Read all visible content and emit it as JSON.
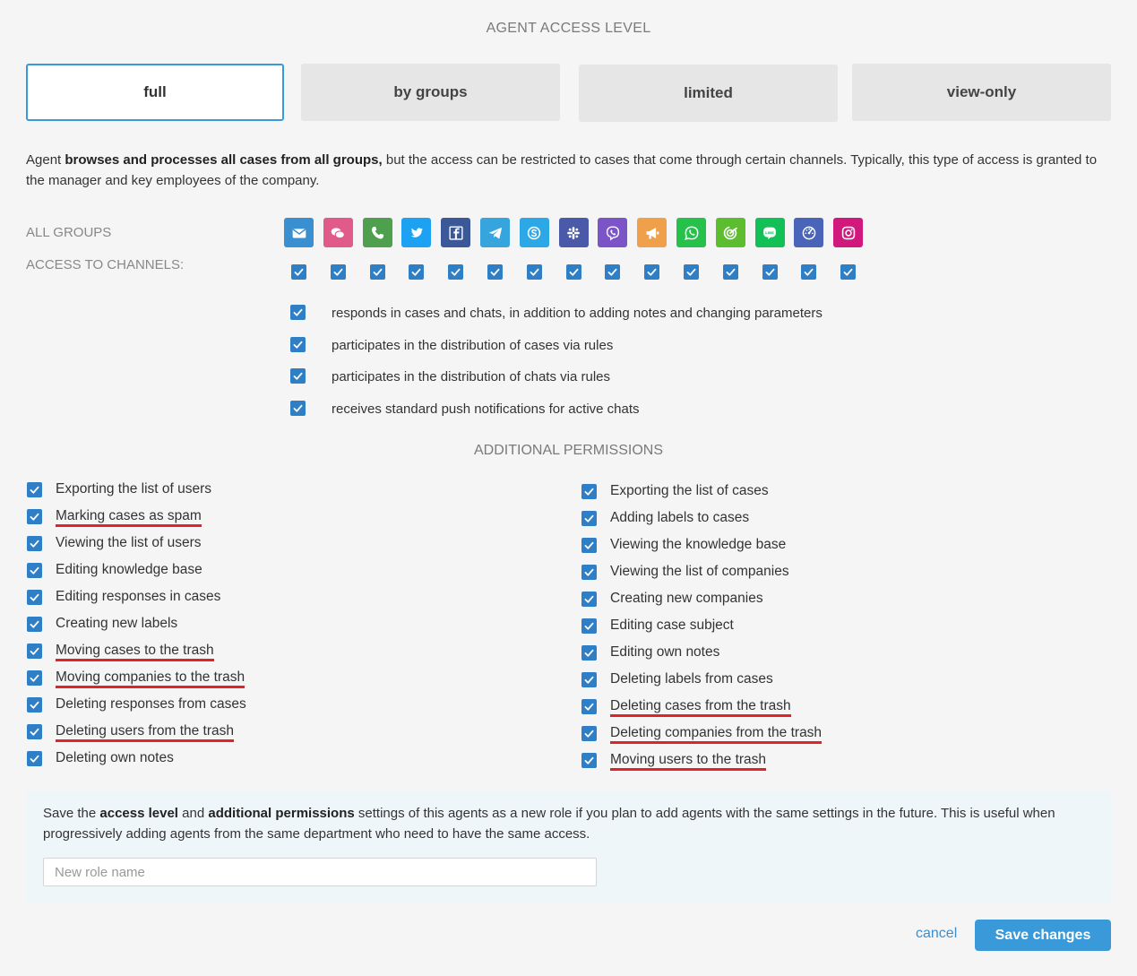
{
  "title": "AGENT ACCESS LEVEL",
  "tabs": [
    {
      "label": "full",
      "active": true
    },
    {
      "label": "by groups",
      "active": false
    },
    {
      "label": "limited",
      "active": false
    },
    {
      "label": "view-only",
      "active": false
    }
  ],
  "description": {
    "prefix": "Agent ",
    "bold": "browses and processes all cases from all groups,",
    "suffix": " but the access can be restricted to cases that come through certain channels. Typically, this type of access is granted to the manager and key employees of the company."
  },
  "labels": {
    "all_groups": "ALL GROUPS",
    "access_channels": "ACCESS TO CHANNELS:"
  },
  "channels": [
    {
      "icon": "email-icon",
      "color": "#3a8fd0",
      "checked": true
    },
    {
      "icon": "chat-icon",
      "color": "#e05a8a",
      "checked": true
    },
    {
      "icon": "phone-icon",
      "color": "#4ea04e",
      "checked": true
    },
    {
      "icon": "twitter-icon",
      "color": "#1da1f2",
      "checked": true
    },
    {
      "icon": "facebook-icon",
      "color": "#3b5998",
      "checked": true
    },
    {
      "icon": "telegram-icon",
      "color": "#37a5dd",
      "checked": true
    },
    {
      "icon": "skype-icon",
      "color": "#2da8e6",
      "checked": true
    },
    {
      "icon": "slack-icon",
      "color": "#4a5aa8",
      "checked": true
    },
    {
      "icon": "viber-icon",
      "color": "#7b55c8",
      "checked": true
    },
    {
      "icon": "megaphone-icon",
      "color": "#f0a04b",
      "checked": true
    },
    {
      "icon": "whatsapp-icon",
      "color": "#25c14a",
      "checked": true
    },
    {
      "icon": "widget-icon",
      "color": "#5cbd2e",
      "checked": true
    },
    {
      "icon": "line-icon",
      "color": "#12c055",
      "checked": true
    },
    {
      "icon": "api-icon",
      "color": "#4964b8",
      "checked": true
    },
    {
      "icon": "instagram-icon",
      "color": "#d1197d",
      "checked": true
    }
  ],
  "options": [
    {
      "label": "responds in cases and chats, in addition to adding notes and changing parameters",
      "checked": true
    },
    {
      "label": "participates in the distribution of cases via rules",
      "checked": true
    },
    {
      "label": "participates in the distribution of chats via rules",
      "checked": true
    },
    {
      "label": "receives standard push notifications for active chats",
      "checked": true
    }
  ],
  "additional_title": "ADDITIONAL PERMISSIONS",
  "permissions_left": [
    {
      "label": "Exporting the list of users",
      "checked": true,
      "underlined": false
    },
    {
      "label": "Marking cases as spam",
      "checked": true,
      "underlined": true
    },
    {
      "label": "Viewing the list of users",
      "checked": true,
      "underlined": false
    },
    {
      "label": "Editing knowledge base",
      "checked": true,
      "underlined": false
    },
    {
      "label": "Editing responses in cases",
      "checked": true,
      "underlined": false
    },
    {
      "label": "Creating new labels",
      "checked": true,
      "underlined": false
    },
    {
      "label": "Moving cases to the trash",
      "checked": true,
      "underlined": true
    },
    {
      "label": "Moving companies to the trash",
      "checked": true,
      "underlined": true
    },
    {
      "label": "Deleting responses from cases",
      "checked": true,
      "underlined": false
    },
    {
      "label": "Deleting users from the trash",
      "checked": true,
      "underlined": true
    },
    {
      "label": "Deleting own notes",
      "checked": true,
      "underlined": false
    }
  ],
  "permissions_right": [
    {
      "label": "Exporting the list of cases",
      "checked": true,
      "underlined": false
    },
    {
      "label": "Adding labels to cases",
      "checked": true,
      "underlined": false
    },
    {
      "label": "Viewing the knowledge base",
      "checked": true,
      "underlined": false
    },
    {
      "label": "Viewing the list of companies",
      "checked": true,
      "underlined": false
    },
    {
      "label": "Creating new companies",
      "checked": true,
      "underlined": false
    },
    {
      "label": "Editing case subject",
      "checked": true,
      "underlined": false
    },
    {
      "label": "Editing own notes",
      "checked": true,
      "underlined": false
    },
    {
      "label": "Deleting labels from cases",
      "checked": true,
      "underlined": false
    },
    {
      "label": "Deleting cases from the trash",
      "checked": true,
      "underlined": true
    },
    {
      "label": "Deleting companies from the trash",
      "checked": true,
      "underlined": true
    },
    {
      "label": "Moving users to the trash",
      "checked": true,
      "underlined": true
    }
  ],
  "save_role": {
    "t1": "Save the ",
    "b1": "access level",
    "t2": " and ",
    "b2": "additional permissions",
    "t3": " settings of this agents as a new role if you plan to add agents with the same settings in the future. This is useful when progressively adding agents from the same department who need to have the same access.",
    "input_value": "",
    "input_placeholder": "New role name"
  },
  "actions": {
    "cancel": "cancel",
    "save": "Save changes"
  },
  "colors": {
    "accent": "#3a9ad9",
    "checkbox": "#2f7fc7",
    "underline": "#e0232b"
  }
}
